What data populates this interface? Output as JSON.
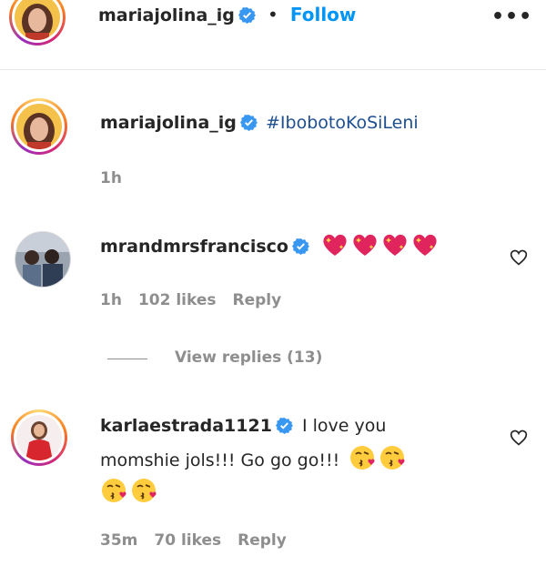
{
  "header": {
    "username": "mariajolina_ig",
    "separator": "•",
    "follow_label": "Follow",
    "more_label": "•••"
  },
  "caption": {
    "username": "mariajolina_ig",
    "text": "#IbobotoKoSiLeni",
    "time": "1h"
  },
  "comments": [
    {
      "username": "mrandmrsfrancisco",
      "text": "",
      "emojis": [
        "sparkling-heart",
        "sparkling-heart",
        "sparkling-heart",
        "sparkling-heart"
      ],
      "time": "1h",
      "likes": "102 likes",
      "reply_label": "Reply",
      "view_replies": "View replies (13)"
    },
    {
      "username": "karlaestrada1121",
      "text_line1": "I love you",
      "text_line2": "momshie jols!!! Go go go!!!",
      "emojis": [
        "face-blowing-kiss",
        "face-blowing-kiss",
        "face-blowing-kiss",
        "face-blowing-kiss"
      ],
      "time": "35m",
      "likes": "70 likes",
      "reply_label": "Reply"
    }
  ],
  "icons": {
    "verified": "verified-badge-icon",
    "like": "heart-outline-icon"
  },
  "colors": {
    "follow": "#0095f6",
    "verified": "#3897f0",
    "hashtag": "#1e4f8f",
    "muted": "#8e8e8e"
  }
}
